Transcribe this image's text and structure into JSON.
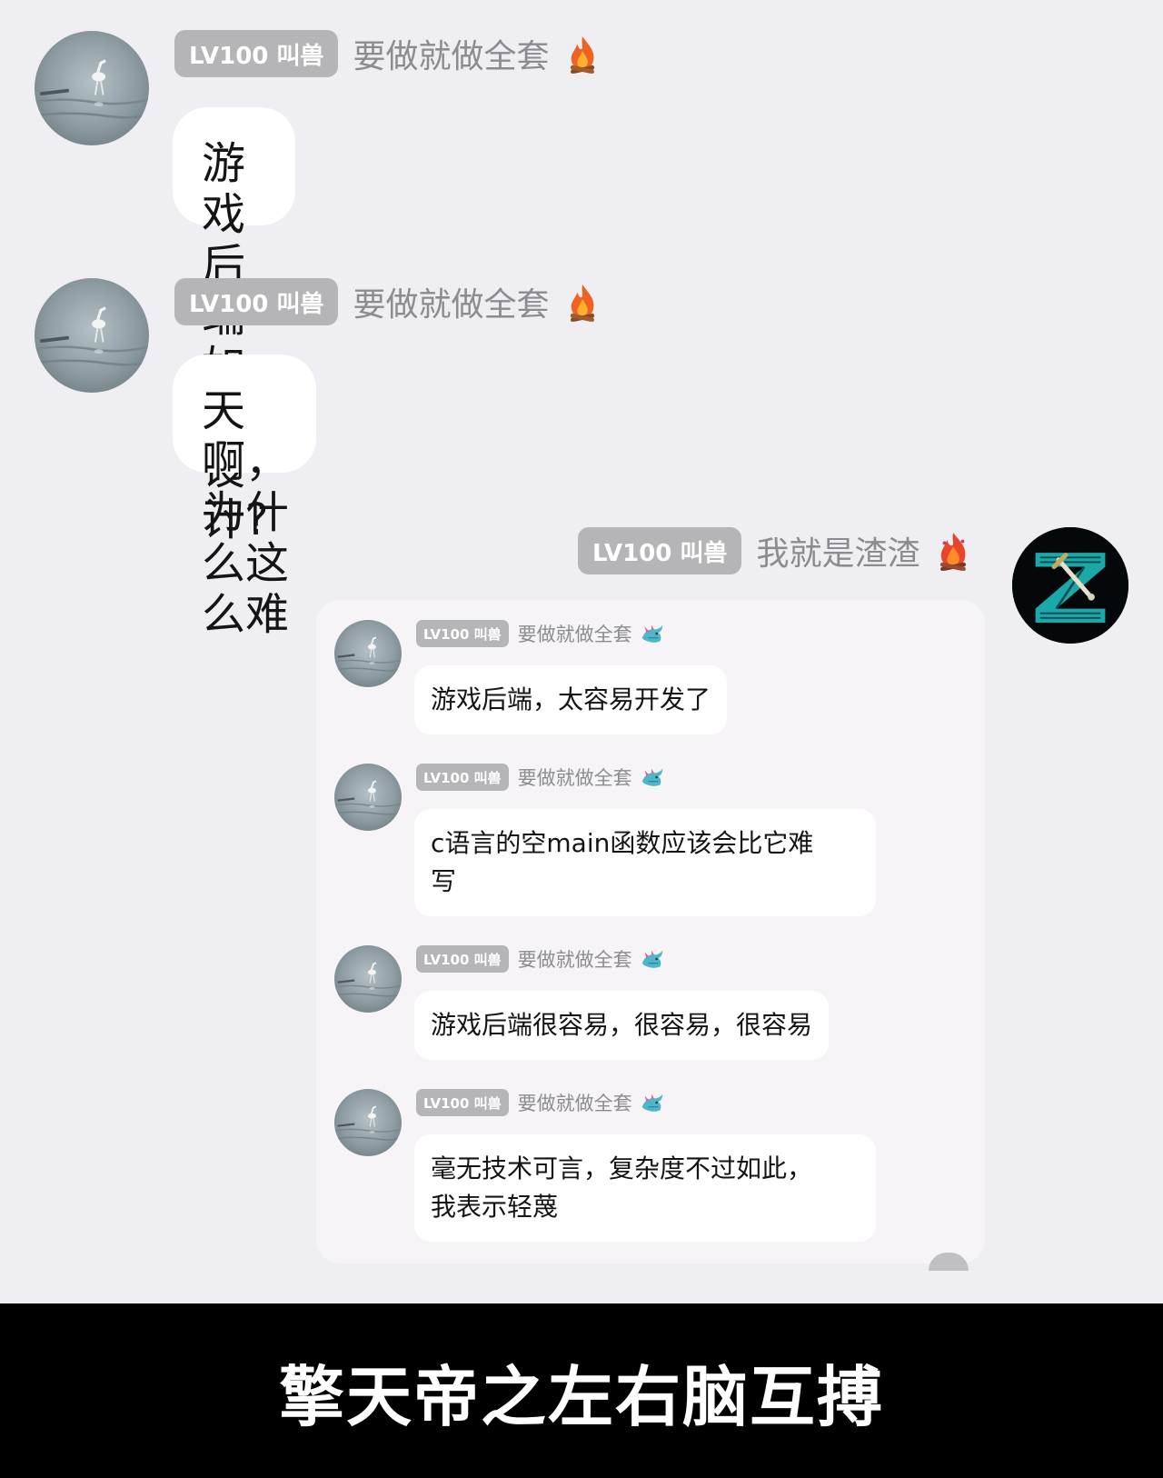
{
  "colors": {
    "background": "#efeff3",
    "bubble": "#ffffff",
    "badge": "#b5b5b8",
    "caption_bar": "#000000"
  },
  "messages": [
    {
      "badge": "LV100 叫兽",
      "name": "要做就做全套",
      "flair_icon": "campfire-icon",
      "text": "游戏后端如何设计?"
    },
    {
      "badge": "LV100 叫兽",
      "name": "要做就做全套",
      "flair_icon": "campfire-icon",
      "text": "天啊，为什么这么难"
    }
  ],
  "self_message": {
    "badge": "LV100 叫兽",
    "name": "我就是渣渣",
    "flair_icon": "bonfire-icon",
    "avatar_icon": "z-logo-avatar"
  },
  "forwarded": [
    {
      "badge": "LV100 叫兽",
      "name": "要做就做全套",
      "flair_icon": "dragon-icon",
      "text": "游戏后端，太容易开发了"
    },
    {
      "badge": "LV100 叫兽",
      "name": "要做就做全套",
      "flair_icon": "dragon-icon",
      "text_line1": "c语言的空main函数应该会比它难",
      "text_line2": "写"
    },
    {
      "badge": "LV100 叫兽",
      "name": "要做就做全套",
      "flair_icon": "dragon-icon",
      "text": "游戏后端很容易，很容易，很容易"
    },
    {
      "badge": "LV100 叫兽",
      "name": "要做就做全套",
      "flair_icon": "dragon-icon",
      "text_line1": "毫无技术可言，复杂度不过如此，",
      "text_line2": "我表示轻蔑"
    }
  ],
  "caption": "擎天帝之左右脑互搏"
}
